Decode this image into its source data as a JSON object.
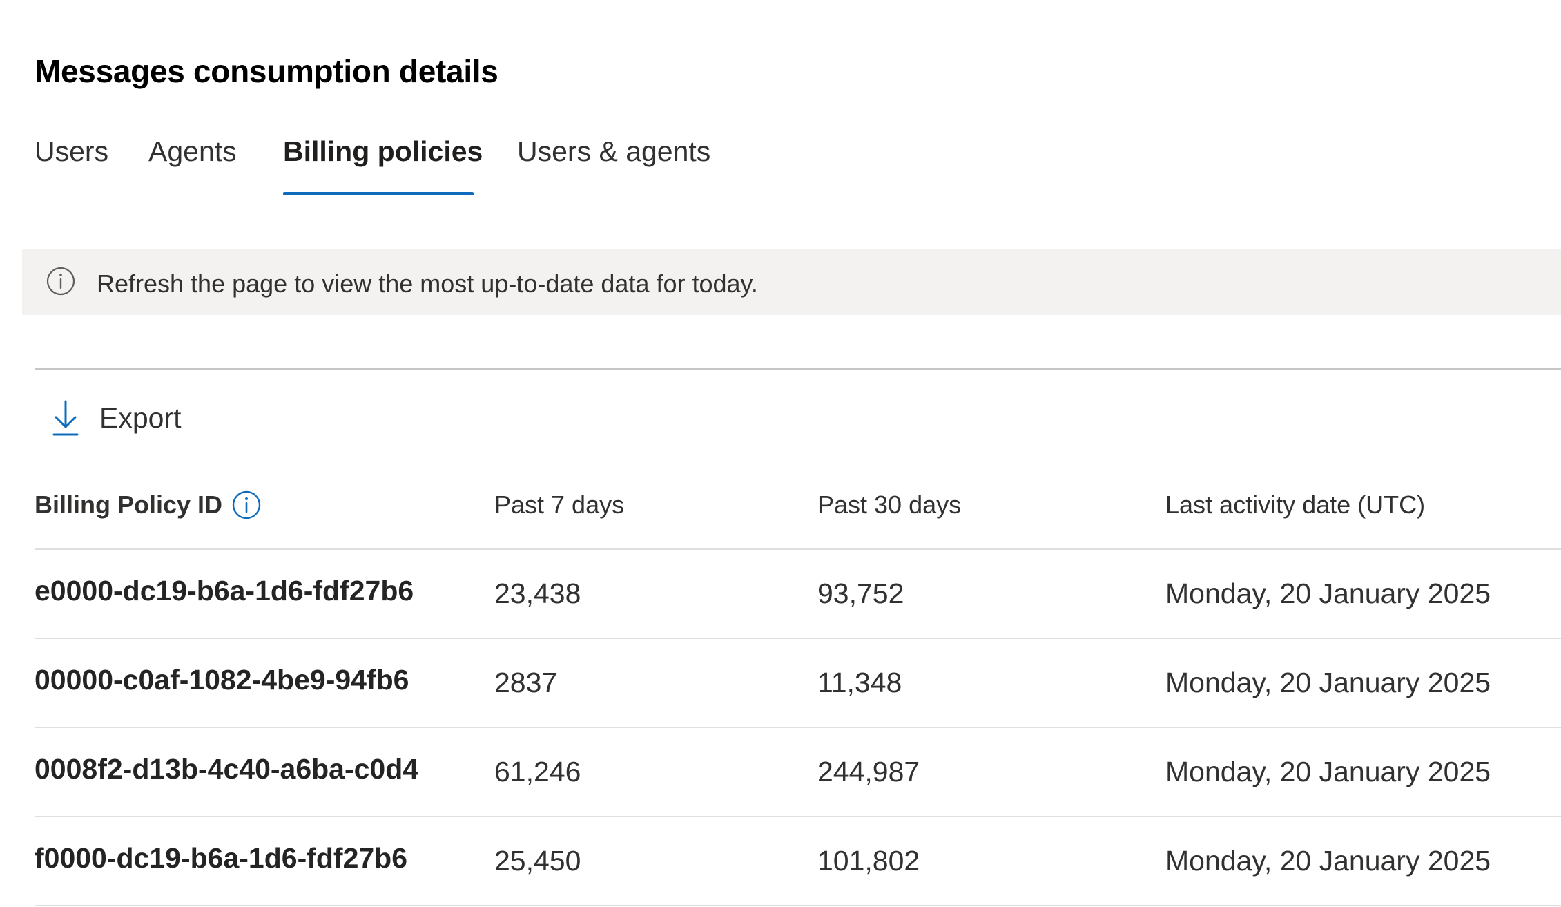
{
  "page": {
    "title": "Messages consumption details"
  },
  "tabs": [
    {
      "label": "Users",
      "active": false
    },
    {
      "label": "Agents",
      "active": false
    },
    {
      "label": "Billing policies",
      "active": true
    },
    {
      "label": "Users & agents",
      "active": false
    }
  ],
  "banner": {
    "icon": "info-icon",
    "text": "Refresh the page to view the most up-to-date data for today."
  },
  "toolbar": {
    "export_label": "Export",
    "export_icon": "download-icon"
  },
  "table": {
    "columns": [
      {
        "label": "Billing Policy ID",
        "info_icon": true
      },
      {
        "label": "Past 7 days"
      },
      {
        "label": "Past 30 days"
      },
      {
        "label": "Last activity date (UTC)"
      }
    ],
    "rows": [
      {
        "id": "e0000-dc19-b6a-1d6-fdf27b6",
        "past7": "23,438",
        "past30": "93,752",
        "last_activity": "Monday, 20 January 2025"
      },
      {
        "id": "00000-c0af-1082-4be9-94fb6",
        "past7": "2837",
        "past30": "11,348",
        "last_activity": "Monday, 20 January 2025"
      },
      {
        "id": "0008f2-d13b-4c40-a6ba-c0d4",
        "past7": "61,246",
        "past30": "244,987",
        "last_activity": "Monday, 20 January 2025"
      },
      {
        "id": "f0000-dc19-b6a-1d6-fdf27b6",
        "past7": "25,450",
        "past30": "101,802",
        "last_activity": "Monday, 20 January 2025"
      }
    ]
  },
  "colors": {
    "accent": "#0f6cbd",
    "banner_bg": "#f3f2f1",
    "divider": "#e1dfdd",
    "text": "#323130"
  }
}
